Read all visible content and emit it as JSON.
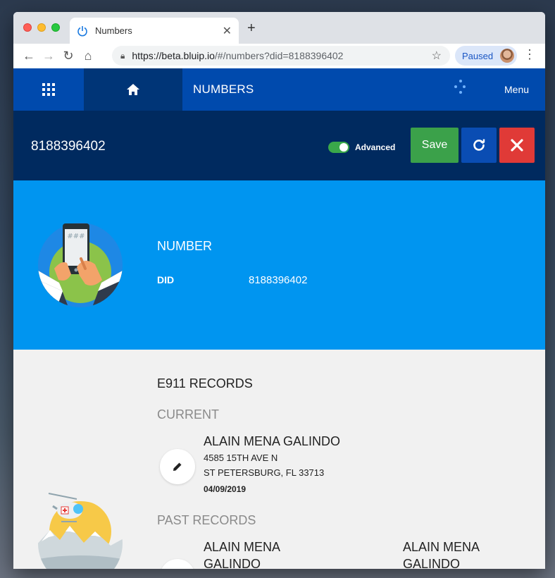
{
  "browser": {
    "tab_title": "Numbers",
    "url_host": "https://beta.bluip.io",
    "url_rest": "/#/numbers?did=8188396402",
    "paused_label": "Paused"
  },
  "appnav": {
    "title": "NUMBERS",
    "menu_label": "Menu"
  },
  "header": {
    "title": "8188396402",
    "advanced_label": "Advanced",
    "advanced_on": true,
    "save_label": "Save"
  },
  "number_panel": {
    "title": "NUMBER",
    "did_label": "DID",
    "did_value": "8188396402"
  },
  "e911": {
    "title": "E911 RECORDS",
    "current_label": "CURRENT",
    "current": {
      "name": "ALAIN MENA GALINDO",
      "address1": "4585 15TH AVE N",
      "address2": "ST PETERSBURG, FL 33713",
      "date": "04/09/2019"
    },
    "past_label": "PAST RECORDS",
    "past": [
      {
        "name_line1": "ALAIN MENA",
        "name_line2": "GALINDO"
      },
      {
        "name_line1": "ALAIN MENA",
        "name_line2": "GALINDO"
      }
    ]
  },
  "colors": {
    "nav_blue": "#004aad",
    "header_navy": "#002a5f",
    "panel_blue": "#0095f0",
    "save_green": "#3ba14a",
    "close_red": "#e03a37"
  }
}
